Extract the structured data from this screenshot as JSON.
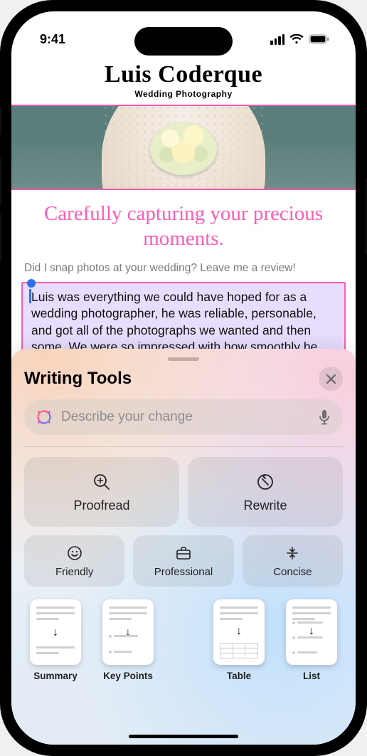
{
  "status": {
    "time": "9:41"
  },
  "page": {
    "brand_name": "Luis Coderque",
    "brand_sub": "Wedding Photography",
    "tagline": "Carefully capturing your precious moments.",
    "prompt": "Did I snap photos at your wedding? Leave me a review!",
    "review_text": "Luis was everything we could have hoped for as a wedding photographer, he was reliable, personable, and got all of the photographs we wanted and then some. We were so impressed with how smoothly he circulated through our ceremony and reception. We barely realized he was there except when he was very"
  },
  "sheet": {
    "title": "Writing Tools",
    "input_placeholder": "Describe your change",
    "big_buttons": [
      {
        "label": "Proofread"
      },
      {
        "label": "Rewrite"
      }
    ],
    "tone_buttons": [
      {
        "label": "Friendly"
      },
      {
        "label": "Professional"
      },
      {
        "label": "Concise"
      }
    ],
    "doc_buttons": [
      {
        "label": "Summary"
      },
      {
        "label": "Key Points"
      },
      {
        "label": "Table"
      },
      {
        "label": "List"
      }
    ]
  }
}
